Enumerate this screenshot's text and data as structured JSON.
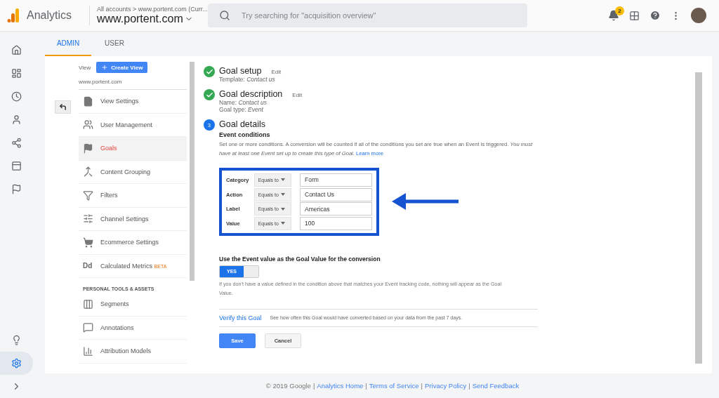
{
  "header": {
    "product": "Analytics",
    "breadcrumb": "All accounts > www.portent.com (Curr...",
    "property": "www.portent.com",
    "search": {
      "placeholder": "Try searching for \"acquisition overview\""
    },
    "notifications": "2"
  },
  "rail": [
    {
      "selected": false
    },
    {
      "selected": false
    },
    {
      "selected": false
    },
    {
      "selected": false
    },
    {
      "selected": false
    },
    {
      "selected": false
    },
    {
      "selected": false
    },
    {
      "selected": false
    },
    {
      "selected": true
    },
    {
      "selected": false
    }
  ],
  "tabs": [
    {
      "label": "ADMIN",
      "selected": true
    },
    {
      "label": "USER",
      "selected": false
    }
  ],
  "view": {
    "label": "View",
    "create_button": "Create View",
    "name": "www.portent.com"
  },
  "nav": [
    {
      "label": "View Settings",
      "selected": false
    },
    {
      "label": "User Management",
      "selected": false
    },
    {
      "label": "Goals",
      "selected": true
    },
    {
      "label": "Content Grouping",
      "selected": false
    },
    {
      "label": "Filters",
      "selected": false
    },
    {
      "label": "Channel Settings",
      "selected": false
    },
    {
      "label": "Ecommerce Settings",
      "selected": false
    },
    {
      "label": "Calculated Metrics",
      "selected": false,
      "icon_text": "Dd",
      "badge": "BETA"
    }
  ],
  "personal": {
    "heading": "PERSONAL TOOLS & ASSETS",
    "items": [
      {
        "label": "Segments",
        "selected": false
      },
      {
        "label": "Annotations",
        "selected": false
      },
      {
        "label": "Attribution Models",
        "selected": false
      }
    ]
  },
  "steps": [
    {
      "kind": "done",
      "title": "Goal setup",
      "edit": "Edit",
      "lines": [
        "Template: *Contact us*"
      ]
    },
    {
      "kind": "done",
      "title": "Goal description",
      "edit": "Edit",
      "lines": [
        "Name: *Contact us*",
        "Goal type: *Event*"
      ]
    },
    {
      "kind": "current",
      "number": "3",
      "title": "Goal details"
    }
  ],
  "event_conditions": {
    "heading": "Event conditions",
    "description": "Set one or more conditions. A conversion will be counted if all of the conditions you set are true when an Event is triggered. *You must have at least one Event set up to create this type of Goal.*",
    "learn_more": "Learn more",
    "conditions": [
      {
        "name": "Category",
        "operator": "Equals to",
        "value": "Form"
      },
      {
        "name": "Action",
        "operator": "Equals to",
        "value": "Contact Us"
      },
      {
        "name": "Label",
        "operator": "Equals to",
        "value": "Americas"
      },
      {
        "name": "Value",
        "operator": "Equals to",
        "value": "100"
      }
    ]
  },
  "goal_value": {
    "label": "Use the Event value as the Goal Value for the conversion",
    "toggle": {
      "on": true,
      "text": "YES"
    },
    "note": "If you don't have a value defined in the condition above that matches your Event tracking code, nothing will appear as the Goal Value."
  },
  "verify": {
    "link": "Verify this Goal",
    "text": "See how often this Goal would have converted based on your data from the past 7 days."
  },
  "buttons": [
    {
      "kind": "primary",
      "label": "Save"
    },
    {
      "kind": "secondary",
      "label": "Cancel"
    }
  ],
  "footer": [
    {
      "kind": "text",
      "text": "© 2019 Google"
    },
    {
      "kind": "sep",
      "text": "|"
    },
    {
      "kind": "link",
      "text": "Analytics Home"
    },
    {
      "kind": "sep",
      "text": "|"
    },
    {
      "kind": "link",
      "text": "Terms of Service"
    },
    {
      "kind": "sep",
      "text": "|"
    },
    {
      "kind": "link",
      "text": "Privacy Policy"
    },
    {
      "kind": "sep",
      "text": "|"
    },
    {
      "kind": "link",
      "text": "Send Feedback"
    }
  ]
}
